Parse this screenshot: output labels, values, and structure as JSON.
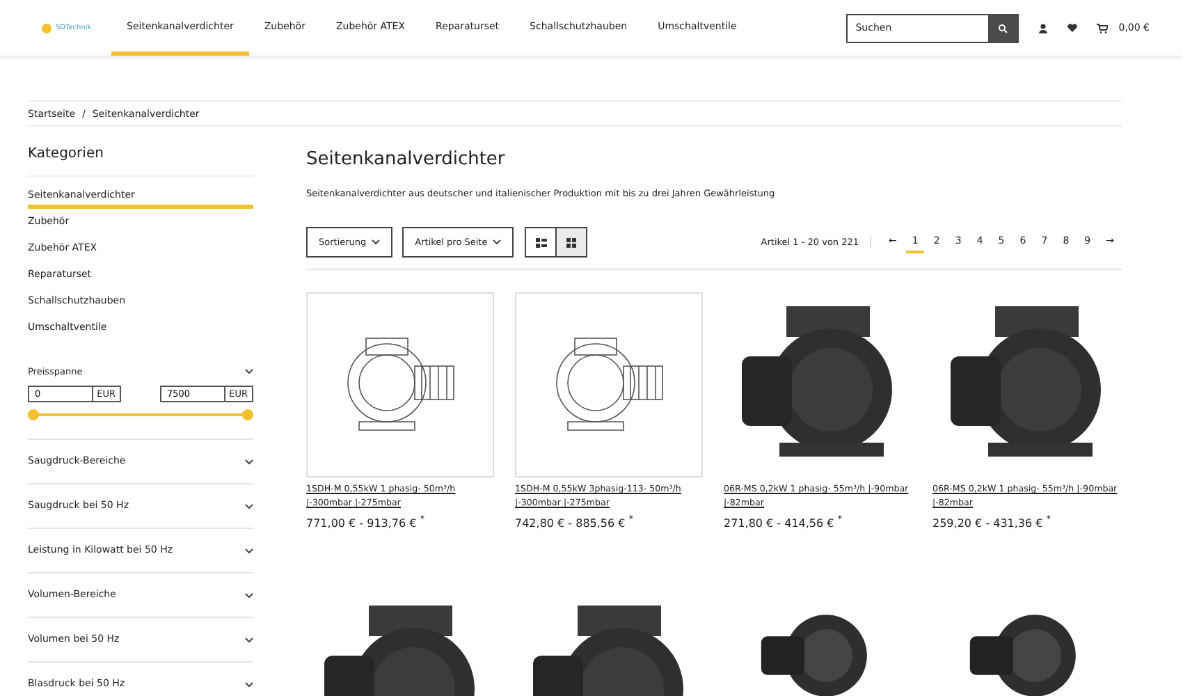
{
  "header": {
    "logo": "SDTechnik",
    "nav": [
      {
        "label": "Seitenkanalverdichter",
        "selected": true
      },
      {
        "label": "Zubehör",
        "selected": false
      },
      {
        "label": "Zubehör ATEX",
        "selected": false
      },
      {
        "label": "Reparaturset",
        "selected": false
      },
      {
        "label": "Schallschutzhauben",
        "selected": false
      },
      {
        "label": "Umschaltventile",
        "selected": false
      }
    ],
    "search": {
      "placeholder": "Suchen"
    },
    "cart_total": "0,00 €"
  },
  "breadcrumb": {
    "items": [
      "Startseite",
      "Seitenkanalverdichter"
    ],
    "separator": "/"
  },
  "sidebar": {
    "title": "Kategorien",
    "categories": [
      {
        "label": "Seitenkanalverdichter",
        "selected": true
      },
      {
        "label": "Zubehör",
        "selected": false
      },
      {
        "label": "Zubehör ATEX",
        "selected": false
      },
      {
        "label": "Reparaturset",
        "selected": false
      },
      {
        "label": "Schallschutzhauben",
        "selected": false
      },
      {
        "label": "Umschaltventile",
        "selected": false
      }
    ],
    "price": {
      "label": "Preisspanne",
      "fields": [
        {
          "value": "0",
          "unit": "EUR"
        },
        {
          "value": "7500",
          "unit": "EUR"
        }
      ],
      "level": 1
    },
    "filters": [
      "Saugdruck-Bereiche",
      "Saugdruck bei 50 Hz",
      "Leistung in Kilowatt bei 50 Hz",
      "Volumen-Bereiche",
      "Volumen bei 50 Hz",
      "Blasdruck bei 50 Hz"
    ]
  },
  "main": {
    "title": "Seitenkanalverdichter",
    "description": "Seitenkanalverdichter aus deutscher und italienischer Produktion mit bis zu drei Jahren Gewährleistung",
    "toolbar": {
      "sort": "Sortierung",
      "per_page": "Artikel pro Seite",
      "views": [
        {
          "kind": "list",
          "selected": false
        },
        {
          "kind": "grid",
          "selected": true
        }
      ],
      "count": "Artikel 1 - 20 von 221",
      "prev": "←",
      "next": "→",
      "pages": [
        {
          "label": "1",
          "selected": true
        },
        {
          "label": "2",
          "selected": false
        },
        {
          "label": "3",
          "selected": false
        },
        {
          "label": "4",
          "selected": false
        },
        {
          "label": "5",
          "selected": false
        },
        {
          "label": "6",
          "selected": false
        },
        {
          "label": "7",
          "selected": false
        },
        {
          "label": "8",
          "selected": false
        },
        {
          "label": "9",
          "selected": false
        }
      ]
    },
    "products": [
      {
        "kind": "sketch",
        "name": "1SDH-M 0,55kW 1 phasig- 50m³/h |-300mbar |-275mbar",
        "price": "771,00 € - 913,76 €",
        "mark": "*"
      },
      {
        "kind": "sketch",
        "name": "1SDH-M 0,55kW 3phasig-113- 50m³/h |-300mbar |-275mbar",
        "price": "742,80 € - 885,56 €",
        "mark": "*"
      },
      {
        "kind": "render",
        "name": "06R-MS 0,2kW 1 phasig- 55m³/h |-90mbar |-82mbar",
        "price": "271,80 € - 414,56 €",
        "mark": "*"
      },
      {
        "kind": "render",
        "name": "06R-MS 0,2kW 1 phasig- 55m³/h |-90mbar |-82mbar",
        "price": "259,20 € - 431,36 €",
        "mark": "*"
      },
      {
        "kind": "render"
      },
      {
        "kind": "render"
      },
      {
        "kind": "compact"
      },
      {
        "kind": "compact"
      }
    ]
  }
}
